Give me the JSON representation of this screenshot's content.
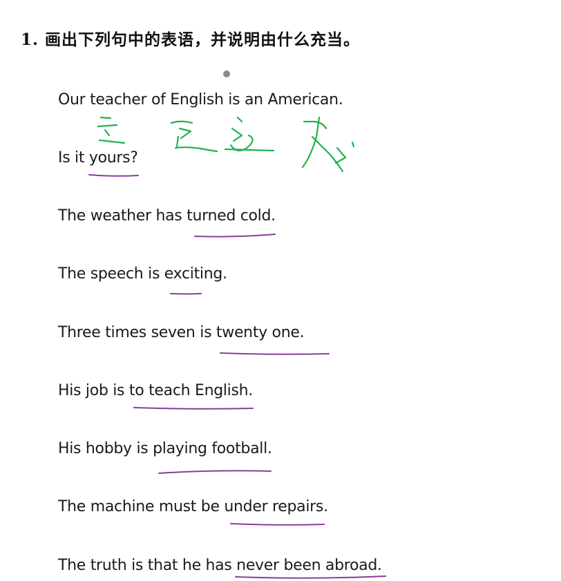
{
  "heading": "1. 画出下列句中的表语，并说明由什么充当。",
  "sentences": [
    "Our teacher of English is an American.",
    "Is it yours?",
    "The weather has turned cold.",
    "The speech is exciting.",
    "Three times seven is twenty one.",
    "His job is to teach English.",
    "His hobby is playing football.",
    "The machine must be under repairs.",
    "The truth is that he has never been abroad."
  ],
  "colors": {
    "text": "#1a1a1a",
    "underline": "#8a3a9a",
    "handwriting": "#1db24a",
    "marker_dot": "#8a8a8a"
  }
}
